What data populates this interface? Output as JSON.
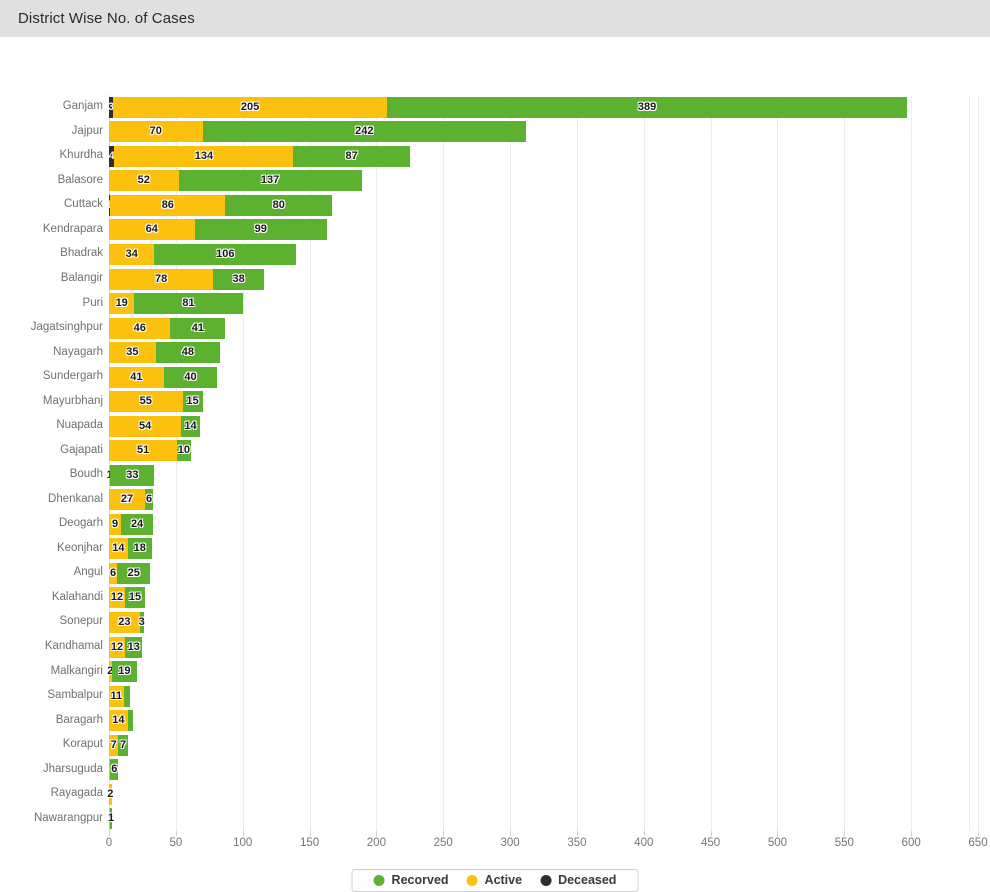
{
  "header": {
    "title": "District Wise No. of Cases",
    "background": "#e0e0e0"
  },
  "legend": {
    "position": "bottom-center",
    "items": [
      {
        "label": "Recorved",
        "color": "#5cb130",
        "icon": "circle-marker-icon"
      },
      {
        "label": "Active",
        "color": "#fcc10f",
        "icon": "circle-marker-icon"
      },
      {
        "label": "Deceased",
        "color": "#2e2e2e",
        "icon": "circle-marker-icon"
      }
    ]
  },
  "colors": {
    "recovered": "#5cb130",
    "active": "#fcc10f",
    "deceased": "#2e2e2e",
    "grid": "#ededed",
    "label_text": "#707070"
  },
  "chart_data": {
    "type": "bar",
    "orientation": "horizontal",
    "stacked": true,
    "title": "District Wise No. of Cases",
    "xlabel": "",
    "ylabel": "",
    "xlim": [
      0,
      650
    ],
    "xticks": [
      0,
      50,
      100,
      150,
      200,
      250,
      300,
      350,
      400,
      450,
      500,
      550,
      600,
      650
    ],
    "grid": true,
    "legend_position": "bottom-center",
    "categories": [
      "Ganjam",
      "Jajpur",
      "Khurdha",
      "Balasore",
      "Cuttack",
      "Kendrapara",
      "Bhadrak",
      "Balangir",
      "Puri",
      "Jagatsinghpur",
      "Nayagarh",
      "Sundergarh",
      "Mayurbhanj",
      "Nuapada",
      "Gajapati",
      "Boudh",
      "Dhenkanal",
      "Deogarh",
      "Keonjhar",
      "Angul",
      "Kalahandi",
      "Sonepur",
      "Kandhamal",
      "Malkangiri",
      "Sambalpur",
      "Baragarh",
      "Koraput",
      "Jharsuguda",
      "Rayagada",
      "Nawarangpur"
    ],
    "series": [
      {
        "name": "Deceased",
        "color": "#2e2e2e",
        "values": [
          3,
          0,
          4,
          0,
          1,
          0,
          0,
          0,
          0,
          0,
          0,
          0,
          0,
          0,
          0,
          0,
          0,
          0,
          0,
          0,
          0,
          0,
          0,
          0,
          0,
          0,
          0,
          0,
          0,
          0
        ]
      },
      {
        "name": "Active",
        "color": "#fcc10f",
        "values": [
          205,
          70,
          134,
          52,
          86,
          64,
          34,
          78,
          19,
          46,
          35,
          41,
          55,
          54,
          51,
          1,
          27,
          9,
          14,
          6,
          12,
          23,
          12,
          2,
          11,
          14,
          7,
          1,
          2,
          1
        ]
      },
      {
        "name": "Recorved",
        "color": "#5cb130",
        "values": [
          389,
          242,
          87,
          137,
          80,
          99,
          106,
          38,
          81,
          41,
          48,
          40,
          15,
          14,
          10,
          33,
          6,
          24,
          18,
          25,
          15,
          3,
          13,
          19,
          5,
          4,
          7,
          6,
          0,
          1
        ]
      }
    ],
    "bar_labels": {
      "Ganjam": {
        "deceased": "3",
        "active": "205",
        "recovered": "389"
      },
      "Jajpur": {
        "deceased": "",
        "active": "70",
        "recovered": "242"
      },
      "Khurdha": {
        "deceased": "4",
        "active": "134",
        "recovered": "87"
      },
      "Balasore": {
        "deceased": "",
        "active": "52",
        "recovered": "137"
      },
      "Cuttack": {
        "deceased": "1",
        "active": "86",
        "recovered": "80"
      },
      "Kendrapara": {
        "deceased": "",
        "active": "64",
        "recovered": "99"
      },
      "Bhadrak": {
        "deceased": "",
        "active": "34",
        "recovered": "106"
      },
      "Balangir": {
        "deceased": "",
        "active": "78",
        "recovered": "38"
      },
      "Puri": {
        "deceased": "",
        "active": "19",
        "recovered": "81"
      },
      "Jagatsinghpur": {
        "deceased": "",
        "active": "46",
        "recovered": "41"
      },
      "Nayagarh": {
        "deceased": "",
        "active": "35",
        "recovered": "48"
      },
      "Sundergarh": {
        "deceased": "",
        "active": "41",
        "recovered": "40"
      },
      "Mayurbhanj": {
        "deceased": "",
        "active": "55",
        "recovered": "15"
      },
      "Nuapada": {
        "deceased": "",
        "active": "54",
        "recovered": "14"
      },
      "Gajapati": {
        "deceased": "",
        "active": "51",
        "recovered": "10"
      },
      "Boudh": {
        "deceased": "",
        "active": "1",
        "recovered": "33"
      },
      "Dhenkanal": {
        "deceased": "",
        "active": "27",
        "recovered": "6"
      },
      "Deogarh": {
        "deceased": "",
        "active": "9",
        "recovered": "24"
      },
      "Keonjhar": {
        "deceased": "",
        "active": "14",
        "recovered": "18"
      },
      "Angul": {
        "deceased": "",
        "active": "6",
        "recovered": "25"
      },
      "Kalahandi": {
        "deceased": "",
        "active": "12",
        "recovered": "15"
      },
      "Sonepur": {
        "deceased": "",
        "active": "23",
        "recovered": "3"
      },
      "Kandhamal": {
        "deceased": "",
        "active": "12",
        "recovered": "13"
      },
      "Malkangiri": {
        "deceased": "",
        "active": "2",
        "recovered": "19"
      },
      "Sambalpur": {
        "deceased": "",
        "active": "11",
        "recovered": ""
      },
      "Baragarh": {
        "deceased": "",
        "active": "14",
        "recovered": ""
      },
      "Koraput": {
        "deceased": "",
        "active": "7",
        "recovered": "7"
      },
      "Jharsuguda": {
        "deceased": "",
        "active": "",
        "recovered": "6"
      },
      "Rayagada": {
        "deceased": "",
        "active": "2",
        "recovered": ""
      },
      "Nawarangpur": {
        "deceased": "",
        "active": "",
        "recovered": "1"
      }
    }
  }
}
